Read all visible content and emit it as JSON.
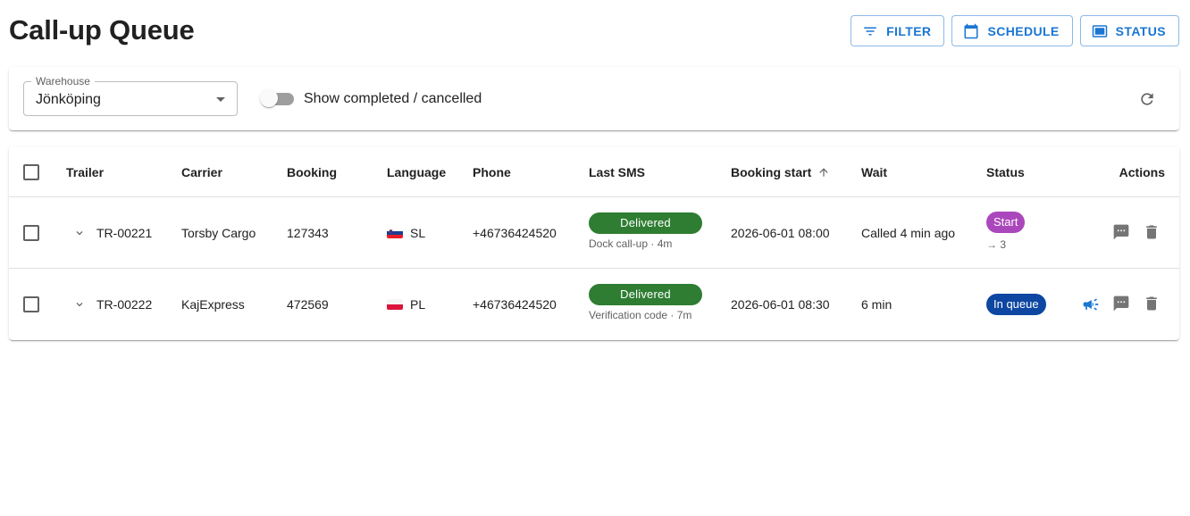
{
  "page": {
    "title": "Call-up Queue"
  },
  "toolbar": {
    "filter_label": "FILTER",
    "schedule_label": "SCHEDULE",
    "status_label": "STATUS",
    "accent": "#1976d2"
  },
  "filters": {
    "warehouse_label": "Warehouse",
    "warehouse_value": "Jönköping",
    "show_completed_label": "Show completed / cancelled",
    "show_completed": false
  },
  "table": {
    "columns": {
      "trailer": "Trailer",
      "carrier": "Carrier",
      "booking": "Booking",
      "language": "Language",
      "phone": "Phone",
      "last_sms": "Last SMS",
      "booking_start": "Booking start",
      "wait": "Wait",
      "status": "Status",
      "actions": "Actions"
    },
    "sort": {
      "column": "Booking start",
      "direction": "ascending"
    },
    "rows": [
      {
        "trailer": "TR-00221",
        "carrier": "Torsby Cargo",
        "booking": "127343",
        "language": "SL",
        "language_flag": "slovenia-flag-icon",
        "phone": "+46736424520",
        "sms_status": "Delivered",
        "sms_detail": "Dock call-up · 4m",
        "booking_start": "2026-06-01 08:00",
        "wait": "Called 4 min ago",
        "status": "Start",
        "status_sub": "→ 3",
        "status_color": "#ab47bc"
      },
      {
        "trailer": "TR-00222",
        "carrier": "KajExpress",
        "booking": "472569",
        "language": "PL",
        "language_flag": "poland-flag-icon",
        "phone": "+46736424520",
        "sms_status": "Delivered",
        "sms_detail": "Verification code · 7m",
        "booking_start": "2026-06-01 08:30",
        "wait": "6 min",
        "status": "In queue",
        "status_sub": "",
        "status_color": "#0d47a1"
      }
    ]
  }
}
